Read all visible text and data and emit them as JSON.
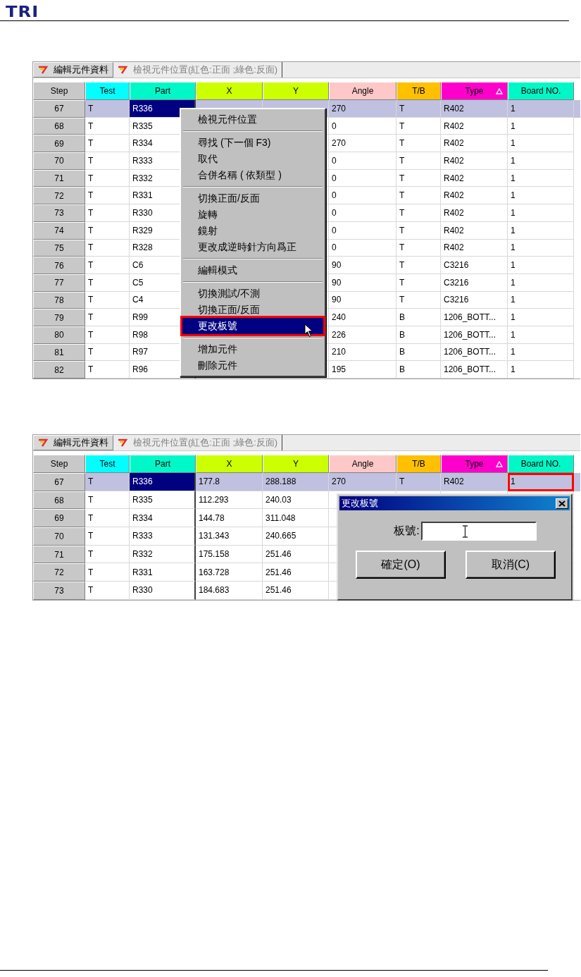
{
  "logo": "TRI",
  "screens": [
    {
      "tabs": [
        {
          "label": "編輯元件資料",
          "selected": true
        },
        {
          "label": "檢視元件位置(紅色:正面 ;綠色:反面)",
          "selected": false
        }
      ],
      "columns": [
        {
          "label": "Step",
          "color": "#c8c8c8",
          "sorted": false
        },
        {
          "label": "Test",
          "color": "#00ffff",
          "sorted": false
        },
        {
          "label": "Part",
          "color": "#00f8c8",
          "sorted": false
        },
        {
          "label": "X",
          "color": "#ccff00",
          "sorted": false
        },
        {
          "label": "Y",
          "color": "#ccff00",
          "sorted": false
        },
        {
          "label": "Angle",
          "color": "#ffc8c8",
          "sorted": false
        },
        {
          "label": "T/B",
          "color": "#ffc000",
          "sorted": false
        },
        {
          "label": "Type",
          "color": "#ff00cc",
          "sorted": true
        },
        {
          "label": "Board NO.",
          "color": "#00f8c8",
          "sorted": false
        }
      ],
      "rows": [
        {
          "step": "67",
          "selected": true,
          "part_focused": true,
          "board_outlined": false,
          "cells": [
            "T",
            "R336",
            null,
            null,
            "270",
            "T",
            "R402",
            "1"
          ]
        },
        {
          "step": "68",
          "selected": false,
          "part_focused": false,
          "board_outlined": false,
          "cells": [
            "T",
            "R335",
            null,
            null,
            "0",
            "T",
            "R402",
            "1"
          ]
        },
        {
          "step": "69",
          "selected": false,
          "part_focused": false,
          "board_outlined": false,
          "cells": [
            "T",
            "R334",
            null,
            null,
            "270",
            "T",
            "R402",
            "1"
          ]
        },
        {
          "step": "70",
          "selected": false,
          "part_focused": false,
          "board_outlined": false,
          "cells": [
            "T",
            "R333",
            null,
            null,
            "0",
            "T",
            "R402",
            "1"
          ]
        },
        {
          "step": "71",
          "selected": false,
          "part_focused": false,
          "board_outlined": false,
          "cells": [
            "T",
            "R332",
            null,
            null,
            "0",
            "T",
            "R402",
            "1"
          ]
        },
        {
          "step": "72",
          "selected": false,
          "part_focused": false,
          "board_outlined": false,
          "cells": [
            "T",
            "R331",
            null,
            null,
            "0",
            "T",
            "R402",
            "1"
          ]
        },
        {
          "step": "73",
          "selected": false,
          "part_focused": false,
          "board_outlined": false,
          "cells": [
            "T",
            "R330",
            null,
            null,
            "0",
            "T",
            "R402",
            "1"
          ]
        },
        {
          "step": "74",
          "selected": false,
          "part_focused": false,
          "board_outlined": false,
          "cells": [
            "T",
            "R329",
            null,
            null,
            "0",
            "T",
            "R402",
            "1"
          ]
        },
        {
          "step": "75",
          "selected": false,
          "part_focused": false,
          "board_outlined": false,
          "cells": [
            "T",
            "R328",
            null,
            null,
            "0",
            "T",
            "R402",
            "1"
          ]
        },
        {
          "step": "76",
          "selected": false,
          "part_focused": false,
          "board_outlined": false,
          "cells": [
            "T",
            "C6",
            null,
            null,
            "90",
            "T",
            "C3216",
            "1"
          ]
        },
        {
          "step": "77",
          "selected": false,
          "part_focused": false,
          "board_outlined": false,
          "cells": [
            "T",
            "C5",
            null,
            null,
            "90",
            "T",
            "C3216",
            "1"
          ]
        },
        {
          "step": "78",
          "selected": false,
          "part_focused": false,
          "board_outlined": false,
          "cells": [
            "T",
            "C4",
            null,
            null,
            "90",
            "T",
            "C3216",
            "1"
          ]
        },
        {
          "step": "79",
          "selected": false,
          "part_focused": false,
          "board_outlined": false,
          "cells": [
            "T",
            "R99",
            null,
            null,
            "240",
            "B",
            "1206_BOTT...",
            "1"
          ]
        },
        {
          "step": "80",
          "selected": false,
          "part_focused": false,
          "board_outlined": false,
          "cells": [
            "T",
            "R98",
            null,
            null,
            "226",
            "B",
            "1206_BOTT...",
            "1"
          ]
        },
        {
          "step": "81",
          "selected": false,
          "part_focused": false,
          "board_outlined": false,
          "cells": [
            "T",
            "R97",
            null,
            null,
            "210",
            "B",
            "1206_BOTT...",
            "1"
          ]
        },
        {
          "step": "82",
          "selected": false,
          "part_focused": false,
          "board_outlined": false,
          "cells": [
            "T",
            "R96",
            null,
            null,
            "195",
            "B",
            "1206_BOTT...",
            "1"
          ]
        }
      ],
      "context_menu": {
        "groups": [
          [
            {
              "label": "檢視元件位置",
              "selected": false,
              "outlined": false
            }
          ],
          [
            {
              "label": "尋找 (下一個 F3)",
              "selected": false,
              "outlined": false
            },
            {
              "label": "取代",
              "selected": false,
              "outlined": false
            },
            {
              "label": "合併名稱 ( 依類型 )",
              "selected": false,
              "outlined": false
            }
          ],
          [
            {
              "label": "切換正面/反面",
              "selected": false,
              "outlined": false
            },
            {
              "label": "旋轉",
              "selected": false,
              "outlined": false
            },
            {
              "label": "鏡射",
              "selected": false,
              "outlined": false
            },
            {
              "label": "更改成逆時針方向爲正",
              "selected": false,
              "outlined": false
            }
          ],
          [
            {
              "label": "編輯模式",
              "selected": false,
              "outlined": false
            }
          ],
          [
            {
              "label": "切換測試/不測",
              "selected": false,
              "outlined": false
            },
            {
              "label": "切換正面/反面",
              "selected": false,
              "outlined": false
            },
            {
              "label": "更改板號",
              "selected": true,
              "outlined": true
            }
          ],
          [
            {
              "label": "增加元件",
              "selected": false,
              "outlined": false
            },
            {
              "label": "刪除元件",
              "selected": false,
              "outlined": false
            }
          ]
        ]
      }
    },
    {
      "tabs": [
        {
          "label": "編輯元件資料",
          "selected": true
        },
        {
          "label": "檢視元件位置(紅色:正面 ;綠色:反面)",
          "selected": false
        }
      ],
      "columns": [
        {
          "label": "Step",
          "color": "#c8c8c8",
          "sorted": false
        },
        {
          "label": "Test",
          "color": "#00ffff",
          "sorted": false
        },
        {
          "label": "Part",
          "color": "#00f8c8",
          "sorted": false
        },
        {
          "label": "X",
          "color": "#ccff00",
          "sorted": false
        },
        {
          "label": "Y",
          "color": "#ccff00",
          "sorted": false
        },
        {
          "label": "Angle",
          "color": "#ffc8c8",
          "sorted": false
        },
        {
          "label": "T/B",
          "color": "#ffc000",
          "sorted": false
        },
        {
          "label": "Type",
          "color": "#ff00cc",
          "sorted": true
        },
        {
          "label": "Board NO.",
          "color": "#00f8c8",
          "sorted": false
        }
      ],
      "rows": [
        {
          "step": "67",
          "selected": true,
          "part_focused": true,
          "board_outlined": true,
          "cells": [
            "T",
            "R336",
            "177.8",
            "288.188",
            "270",
            "T",
            "R402",
            "1"
          ]
        },
        {
          "step": "68",
          "selected": false,
          "part_focused": false,
          "board_outlined": false,
          "cells": [
            "T",
            "R335",
            "112.293",
            "240.03"
          ]
        },
        {
          "step": "69",
          "selected": false,
          "part_focused": false,
          "board_outlined": false,
          "cells": [
            "T",
            "R334",
            "144.78",
            "311.048"
          ]
        },
        {
          "step": "70",
          "selected": false,
          "part_focused": false,
          "board_outlined": false,
          "cells": [
            "T",
            "R333",
            "131.343",
            "240.665"
          ]
        },
        {
          "step": "71",
          "selected": false,
          "part_focused": false,
          "board_outlined": false,
          "cells": [
            "T",
            "R332",
            "175.158",
            "251.46"
          ]
        },
        {
          "step": "72",
          "selected": false,
          "part_focused": false,
          "board_outlined": false,
          "cells": [
            "T",
            "R331",
            "163.728",
            "251.46"
          ]
        },
        {
          "step": "73",
          "selected": false,
          "part_focused": false,
          "board_outlined": false,
          "cells": [
            "T",
            "R330",
            "184.683",
            "251.46"
          ]
        }
      ],
      "dialog": {
        "title": "更改板號",
        "field_label": "板號:",
        "buttons": [
          "確定(O)",
          "取消(C)"
        ]
      }
    }
  ]
}
